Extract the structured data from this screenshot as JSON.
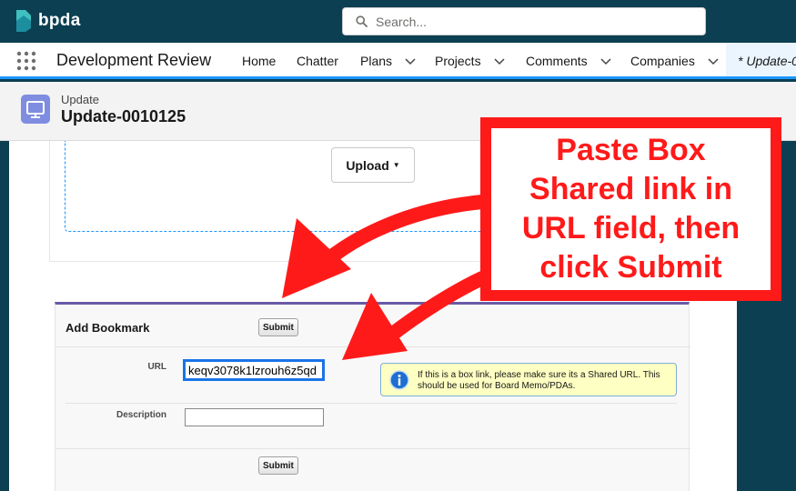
{
  "brand": {
    "name": "bpda"
  },
  "search": {
    "placeholder": "Search..."
  },
  "nav": {
    "app_name": "Development Review",
    "items": [
      {
        "label": "Home",
        "has_menu": false
      },
      {
        "label": "Chatter",
        "has_menu": false
      },
      {
        "label": "Plans",
        "has_menu": true
      },
      {
        "label": "Projects",
        "has_menu": true
      },
      {
        "label": "Comments",
        "has_menu": true
      },
      {
        "label": "Companies",
        "has_menu": true
      }
    ],
    "active_tab": "* Update-0"
  },
  "record": {
    "type": "Update",
    "name": "Update-0010125"
  },
  "upload": {
    "button_label": "Upload"
  },
  "bookmark": {
    "title": "Add Bookmark",
    "submit_label": "Submit",
    "url_label": "URL",
    "url_value": "keqv3078k1lzrouh6z5qd",
    "description_label": "Description",
    "description_value": "",
    "info_text": "If this is a box link, please make sure its a Shared URL. This should be used for Board Memo/PDAs."
  },
  "annotation": {
    "lines": [
      "Paste Box",
      "Shared link in",
      "URL field, then",
      "click Submit"
    ]
  },
  "colors": {
    "header_bg": "#0c3f52",
    "nav_accent": "#1b96ff",
    "annotation_red": "#ff1a1a",
    "record_icon": "#7f8de1"
  }
}
